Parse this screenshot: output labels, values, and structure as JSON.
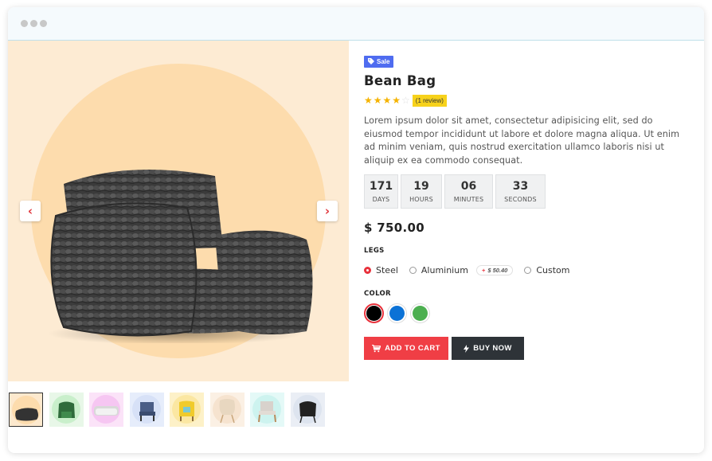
{
  "product": {
    "badge": "Sale",
    "title": "Bean Bag",
    "rating": 4,
    "rating_max": 5,
    "review_label": "(1 review)",
    "description": "Lorem ipsum dolor sit amet, consectetur adipisicing elit, sed do eiusmod tempor incididunt ut labore et dolore magna aliqua. Ut enim ad minim veniam, quis nostrud exercitation ullamco laboris nisi ut aliquip ex ea commodo consequat.",
    "price": "$ 750.00"
  },
  "countdown": [
    {
      "value": "171",
      "label": "DAYS"
    },
    {
      "value": "19",
      "label": "HOURS"
    },
    {
      "value": "06",
      "label": "MINUTES"
    },
    {
      "value": "33",
      "label": "SECONDS"
    }
  ],
  "legs": {
    "title": "LEGS",
    "options": [
      {
        "label": "Steel",
        "selected": true
      },
      {
        "label": "Aluminium",
        "selected": false,
        "extra": "$ 50.40"
      },
      {
        "label": "Custom",
        "selected": false
      }
    ]
  },
  "color": {
    "title": "COLOR",
    "swatches": [
      {
        "name": "black",
        "hex": "#000000",
        "selected": true
      },
      {
        "name": "blue",
        "hex": "#0b72d6",
        "selected": false
      },
      {
        "name": "green",
        "hex": "#4caf50",
        "selected": false
      }
    ]
  },
  "buttons": {
    "add_to_cart": "ADD TO CART",
    "buy_now": "BUY NOW"
  },
  "gallery": {
    "prev_icon": "chevron-left-icon",
    "next_icon": "chevron-right-icon",
    "thumbnails": [
      {
        "name": "black-bean-bag",
        "bg": "#fddcad"
      },
      {
        "name": "green-armchair",
        "bg": "#c9efcb"
      },
      {
        "name": "white-sofa",
        "bg": "#f6c6f2"
      },
      {
        "name": "blue-chair",
        "bg": "#d7e1f7"
      },
      {
        "name": "yellow-armchair",
        "bg": "#fbe7a2"
      },
      {
        "name": "wicker-chair",
        "bg": "#f6e3cf"
      },
      {
        "name": "wooden-armchair",
        "bg": "#cdf3ef"
      },
      {
        "name": "black-lounge-chair",
        "bg": "#dde4ef"
      }
    ]
  },
  "colors": {
    "accent": "#e8313b",
    "sale_badge": "#4f6cf0",
    "review_badge": "#f7d21b",
    "buy_now": "#2e3338"
  }
}
